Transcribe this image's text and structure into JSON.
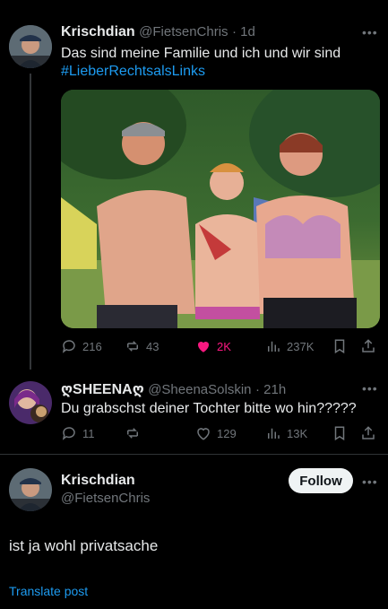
{
  "tweet1": {
    "display_name": "Krischdian",
    "handle": "@FietsenChris",
    "time": "· 1d",
    "text": "Das sind meine Familie und ich und wir sind",
    "hashtag": "#LieberRechtsalsLinks",
    "actions": {
      "replies": "216",
      "reposts": "43",
      "likes": "2K",
      "views": "237K"
    }
  },
  "tweet2": {
    "display_name": "ღSHEENAღ",
    "handle": "@SheenaSolskin",
    "time": "· 21h",
    "text": "Du grabschst deiner Tochter bitte wo hin?????",
    "actions": {
      "replies": "11",
      "reposts": "",
      "likes": "129",
      "views": "13K"
    }
  },
  "tweet3": {
    "display_name": "Krischdian",
    "handle": "@FietsenChris",
    "follow_label": "Follow",
    "text": "ist ja wohl privatsache",
    "translate_label": "Translate post"
  },
  "colors": {
    "background": "#000000",
    "text": "#e7e9ea",
    "muted": "#71767b",
    "link": "#1d9bf0",
    "like": "#f91880"
  },
  "icons": [
    "more-icon",
    "reply-icon",
    "repost-icon",
    "like-icon",
    "views-icon",
    "bookmark-icon",
    "share-icon"
  ]
}
